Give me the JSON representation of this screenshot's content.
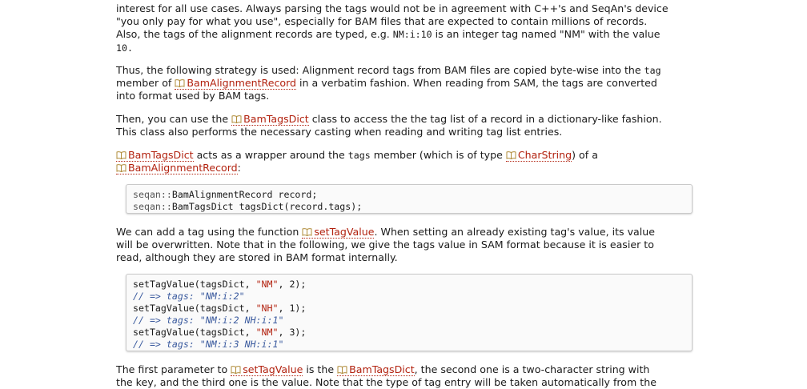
{
  "para1": {
    "l1": "interest for all use cases. Always parsing the tags would not be in agreement with C++'s and SeqAn's device",
    "l2": "\"you only pay for what you use\", especially for BAM files that are expected to contain millions of records.",
    "l3a": "Also, the tags of the alignment records are typed, e.g. ",
    "l3code": "NM:i:10",
    "l3b": " is an integer tag named \"NM\" with the value",
    "l4code": "10."
  },
  "para2": {
    "l1a": "Thus, the following strategy is used: Alignment record tags from BAM files are copied byte-wise into the ",
    "l1code": "tag",
    "l2a": "member of ",
    "l2link": "BamAlignmentRecord",
    "l2b": " in a verbatim fashion. When reading from SAM, the tags are converted",
    "l3": "into format used by BAM tags."
  },
  "para3": {
    "l1a": "Then, you can use the ",
    "l1link": "BamTagsDict",
    "l1b": " class to access the the tag list of a record in a dictionary-like fashion.",
    "l2": "This class also performs the necessary casting when reading and writing tag list entries."
  },
  "para4": {
    "l1link": "BamTagsDict",
    "l1a": " acts as a wrapper around the ",
    "l1code": "tags",
    "l1b": " member (which is of type ",
    "l1link2": "CharString",
    "l1c": ") of a",
    "l2link": "BamAlignmentRecord",
    "l2a": ":"
  },
  "code1": {
    "line1_ns": "seqan::",
    "line1_rest": "BamAlignmentRecord record;",
    "line2_ns": "seqan::",
    "line2_rest": "BamTagsDict tagsDict(record.tags);"
  },
  "para5": {
    "l1a": "We can add a tag using the function ",
    "l1link": "setTagValue",
    "l1b": ". When setting an already existing tag's value, its value",
    "l2": "will be overwritten. Note that in the following, we give the tags value in SAM format because it is easier to",
    "l3": "read, although they are stored in BAM format internally."
  },
  "code2": {
    "lines": [
      {
        "pre": "setTagValue(tagsDict, ",
        "str": "\"NM\"",
        "post": ", 2);"
      },
      {
        "comment": "// => tags: \"NM:i:2\""
      },
      {
        "pre": "setTagValue(tagsDict, ",
        "str": "\"NH\"",
        "post": ", 1);"
      },
      {
        "comment": "// => tags: \"NM:i:2 NH:i:1\""
      },
      {
        "pre": "setTagValue(tagsDict, ",
        "str": "\"NM\"",
        "post": ", 3);"
      },
      {
        "comment": "// => tags: \"NM:i:3 NH:i:1\""
      }
    ]
  },
  "para6": {
    "l1a": "The first parameter to ",
    "l1link": "setTagValue",
    "l1b": " is the ",
    "l1link2": "BamTagsDict",
    "l1c": ", the second one is a two-character string with",
    "l2": "the key, and the third one is the value. Note that the type of tag entry will be taken automatically from the"
  }
}
